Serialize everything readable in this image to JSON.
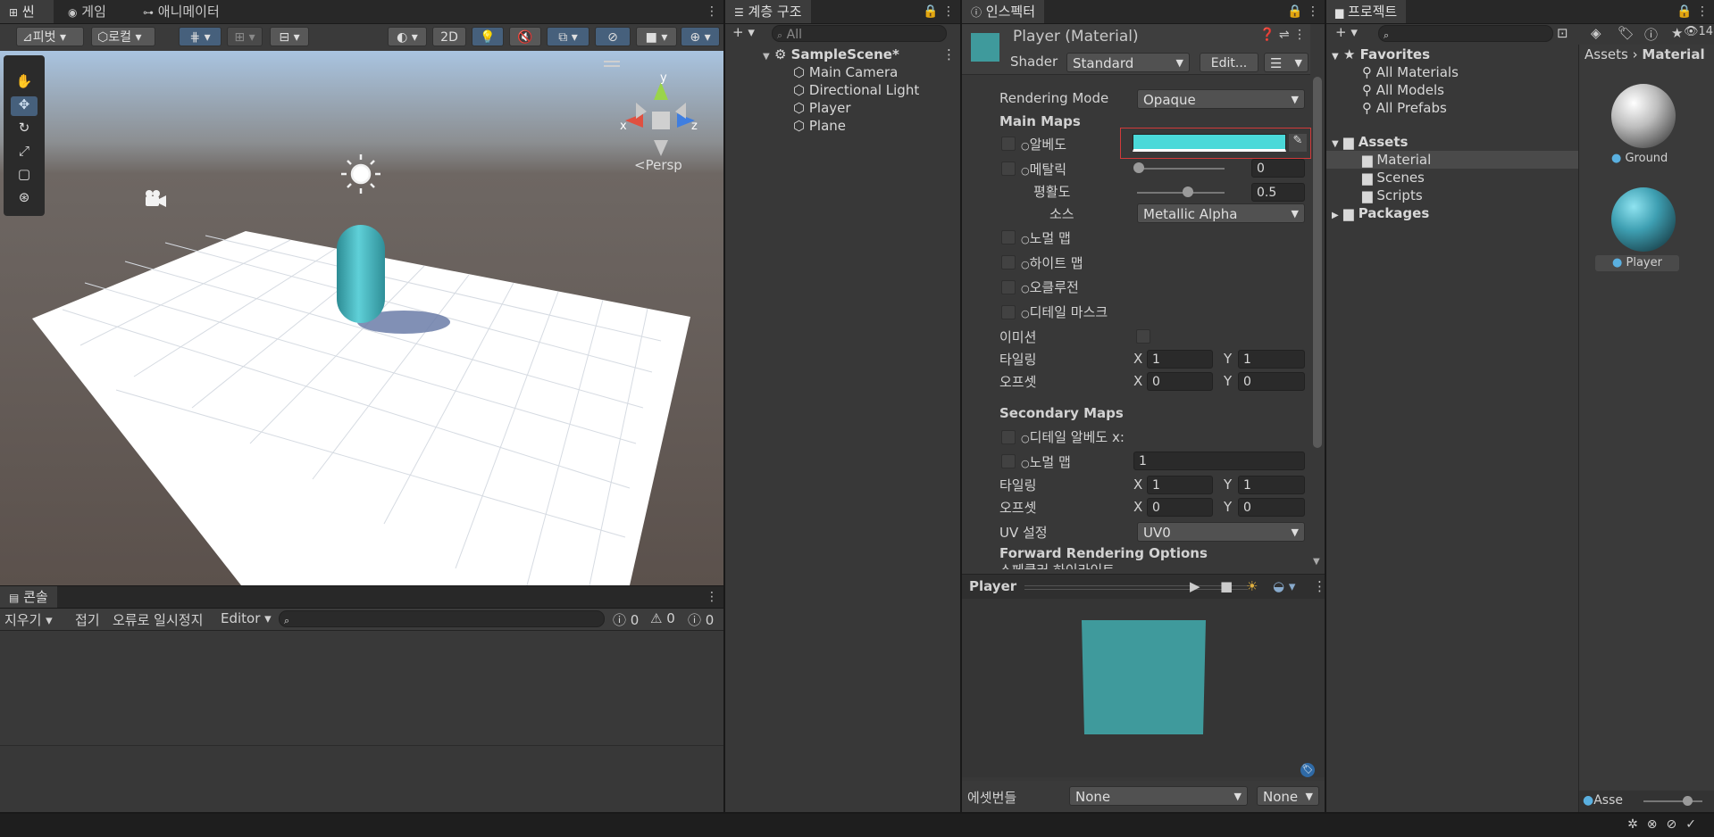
{
  "scene": {
    "tabs": [
      "씬",
      "게임",
      "애니메이터"
    ],
    "pivot_label": "피벗",
    "local_label": "로컬",
    "btn_2d": "2D",
    "persp_label": "Persp",
    "gizmo_x": "x",
    "gizmo_y": "y",
    "gizmo_z": "z"
  },
  "console": {
    "tab": "콘솔",
    "clear": "지우기",
    "collapse": "접기",
    "error_pause": "오류로 일시정지",
    "editor": "Editor",
    "count_info": "0",
    "count_warn": "0",
    "count_error": "0"
  },
  "hierarchy": {
    "tab": "계층 구조",
    "search_placeholder": "All",
    "scene_name": "SampleScene*",
    "items": [
      "Main Camera",
      "Directional Light",
      "Player",
      "Plane"
    ]
  },
  "inspector": {
    "tab": "인스펙터",
    "title": "Player (Material)",
    "shader_label": "Shader",
    "shader_value": "Standard",
    "edit_button": "Edit...",
    "rendering_mode_label": "Rendering Mode",
    "rendering_mode_value": "Opaque",
    "main_maps": "Main Maps",
    "albedo": "알베도",
    "albedo_color": "#4ad9d9",
    "metallic": "메탈릭",
    "metallic_value": "0",
    "smoothness": "평활도",
    "smoothness_value": "0.5",
    "source": "소스",
    "source_value": "Metallic Alpha",
    "normal_map": "노멀 맵",
    "height_map": "하이트 맵",
    "occlusion": "오클루전",
    "detail_mask": "디테일 마스크",
    "emission": "이미션",
    "tiling": "타일링",
    "offset": "오프셋",
    "tiling_x": "1",
    "tiling_y": "1",
    "offset_x": "0",
    "offset_y": "0",
    "secondary_maps": "Secondary Maps",
    "detail_albedo": "디테일 알베도 x:",
    "normal_map2": "노멀 맵",
    "normal_map2_value": "1",
    "tiling2_x": "1",
    "tiling2_y": "1",
    "offset2_x": "0",
    "offset2_y": "0",
    "uv_label": "UV 설정",
    "uv_value": "UV0",
    "forward_options": "Forward Rendering Options",
    "specular_partial": "스페큘러 하이라이트",
    "axis_x": "X",
    "axis_y": "Y",
    "preview_title": "Player",
    "preview_color": "#3f9a9c",
    "assetbundle_label": "에셋번들",
    "assetbundle_value": "None",
    "assetbundle_variant": "None"
  },
  "project": {
    "tab": "프로젝트",
    "count": "14",
    "favorites": "Favorites",
    "fav_items": [
      "All Materials",
      "All Models",
      "All Prefabs"
    ],
    "assets": "Assets",
    "asset_folders": [
      "Material",
      "Scenes",
      "Scripts"
    ],
    "packages": "Packages",
    "breadcrumb_root": "Assets",
    "breadcrumb_current": "Material",
    "items": [
      "Ground",
      "Player"
    ],
    "footer_label": "Asse"
  }
}
